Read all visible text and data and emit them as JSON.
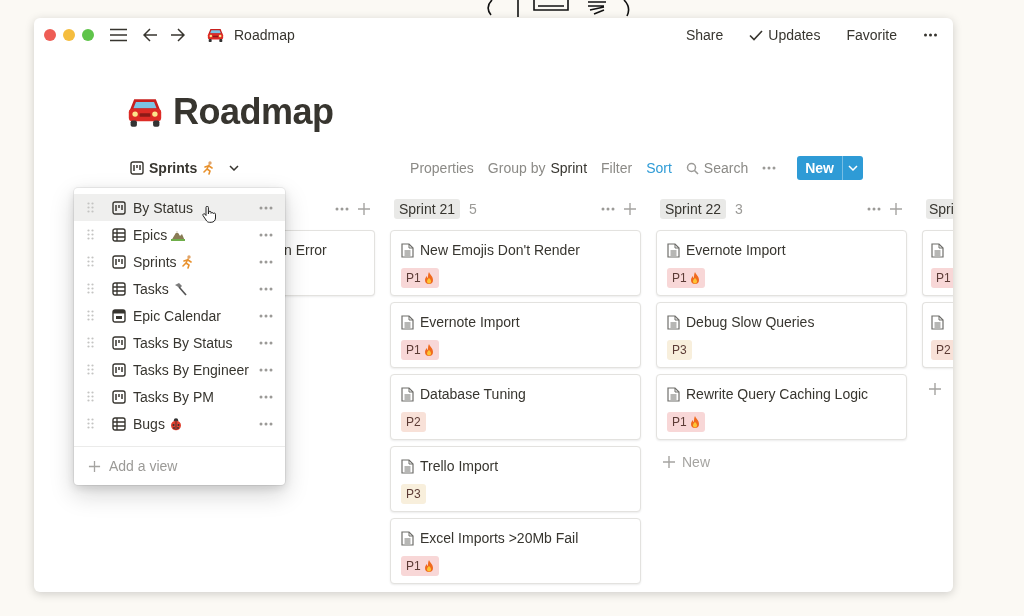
{
  "window": {
    "title": "Roadmap",
    "actions": [
      {
        "kind": "text",
        "label": "Share"
      },
      {
        "kind": "check",
        "label": "Updates"
      },
      {
        "kind": "text",
        "label": "Favorite"
      },
      {
        "kind": "more"
      }
    ]
  },
  "page": {
    "title": "Roadmap"
  },
  "view_switcher": {
    "label": "Sprints",
    "badge": {
      "kind": "runner"
    }
  },
  "toolbar": {
    "items": [
      {
        "kind": "plain",
        "label": "Properties"
      },
      {
        "kind": "group",
        "label": "Group by",
        "value": "Sprint"
      },
      {
        "kind": "plain",
        "label": "Filter"
      },
      {
        "kind": "active",
        "label": "Sort"
      },
      {
        "kind": "search",
        "label": "Search"
      },
      {
        "kind": "more"
      }
    ],
    "new_button": "New"
  },
  "views_menu": {
    "items": [
      {
        "label": "By Status",
        "kind": "board",
        "selected": true
      },
      {
        "label": "Epics",
        "kind": "table",
        "badge": {
          "kind": "mountain"
        },
        "selected": false
      },
      {
        "label": "Sprints",
        "kind": "board",
        "badge": {
          "kind": "runner"
        },
        "selected": false
      },
      {
        "label": "Tasks",
        "kind": "table",
        "badge": {
          "kind": "hammer"
        },
        "selected": false
      },
      {
        "label": "Epic Calendar",
        "kind": "calendar",
        "selected": false
      },
      {
        "label": "Tasks By Status",
        "kind": "board",
        "selected": false
      },
      {
        "label": "Tasks By Engineer",
        "kind": "board",
        "selected": false
      },
      {
        "label": "Tasks By PM",
        "kind": "board",
        "selected": false
      },
      {
        "label": "Bugs",
        "kind": "table",
        "badge": {
          "kind": "ladybug"
        },
        "selected": false
      }
    ],
    "add_label": "Add a view"
  },
  "board": {
    "columns": [
      {
        "kind": "cut_left",
        "add_row": false,
        "cards": [
          {
            "title": "n Error"
          }
        ]
      },
      {
        "kind": "full",
        "label": "Sprint 21",
        "count": "5",
        "add_row": false,
        "cards": [
          {
            "title": "New Emojis Don't Render",
            "tag": {
              "label": "P1",
              "flame": true,
              "color": "#f8d7d7"
            }
          },
          {
            "title": "Evernote Import",
            "tag": {
              "label": "P1",
              "flame": true,
              "color": "#f8d7d7"
            }
          },
          {
            "title": "Database Tuning",
            "tag": {
              "label": "P2",
              "flame": false,
              "color": "#f8e1d8"
            }
          },
          {
            "title": "Trello Import",
            "tag": {
              "label": "P3",
              "flame": false,
              "color": "#f8efdc"
            }
          },
          {
            "title": "Excel Imports >20Mb Fail",
            "tag": {
              "label": "P1",
              "flame": true,
              "color": "#f8d7d7"
            }
          }
        ]
      },
      {
        "kind": "full",
        "label": "Sprint 22",
        "count": "3",
        "add_row": true,
        "add_label": "New",
        "cards": [
          {
            "title": "Evernote Import",
            "tag": {
              "label": "P1",
              "flame": true,
              "color": "#f8d7d7"
            }
          },
          {
            "title": "Debug Slow Queries",
            "tag": {
              "label": "P3",
              "flame": false,
              "color": "#f8efdc"
            }
          },
          {
            "title": "Rewrite Query Caching Logic",
            "tag": {
              "label": "P1",
              "flame": true,
              "color": "#f8d7d7"
            }
          }
        ]
      },
      {
        "kind": "cut_right",
        "label": "Spri",
        "add_row": true,
        "cards": [
          {
            "tag": {
              "label": "P1",
              "flame": false,
              "color": "#f8d7d7"
            }
          },
          {
            "tag": {
              "label": "P2",
              "flame": false,
              "color": "#f8e1d8"
            }
          }
        ]
      }
    ]
  }
}
